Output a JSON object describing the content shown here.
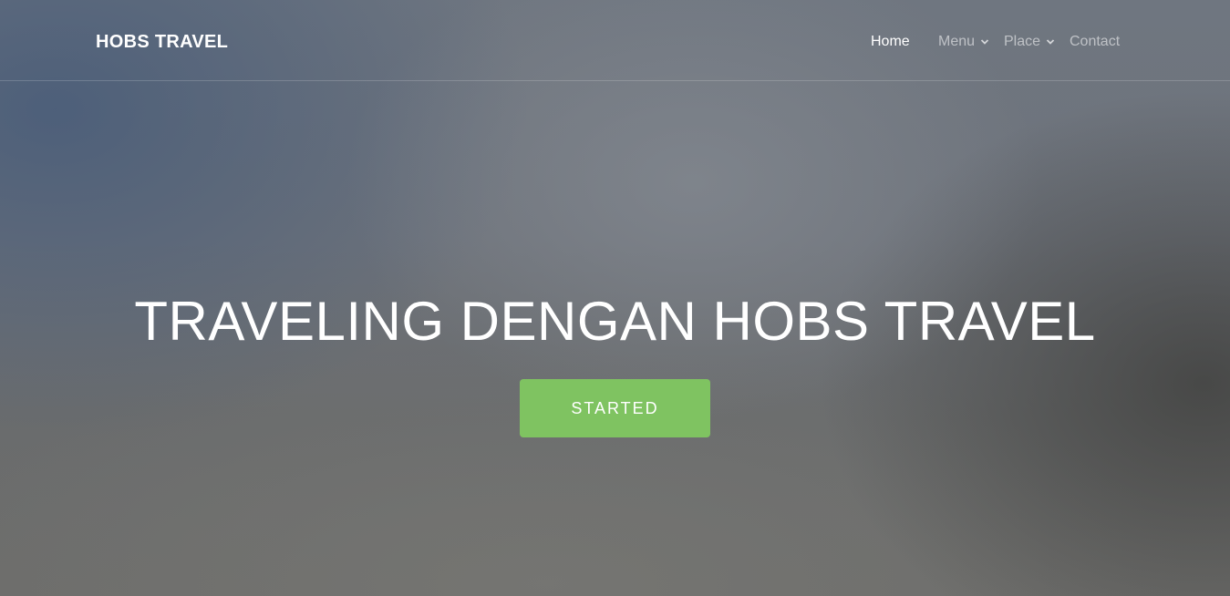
{
  "navbar": {
    "brand": "HOBS TRAVEL",
    "items": [
      {
        "label": "Home",
        "active": true,
        "dropdown": false
      },
      {
        "label": "Menu",
        "active": false,
        "dropdown": true
      },
      {
        "label": "Place",
        "active": false,
        "dropdown": true
      },
      {
        "label": "Contact",
        "active": false,
        "dropdown": false
      }
    ]
  },
  "hero": {
    "title": "TRAVELING DENGAN HOBS TRAVEL",
    "cta_label": "STARTED"
  },
  "colors": {
    "accent": "#7fc361",
    "text": "#ffffff",
    "nav_inactive": "rgba(255,255,255,0.55)"
  }
}
